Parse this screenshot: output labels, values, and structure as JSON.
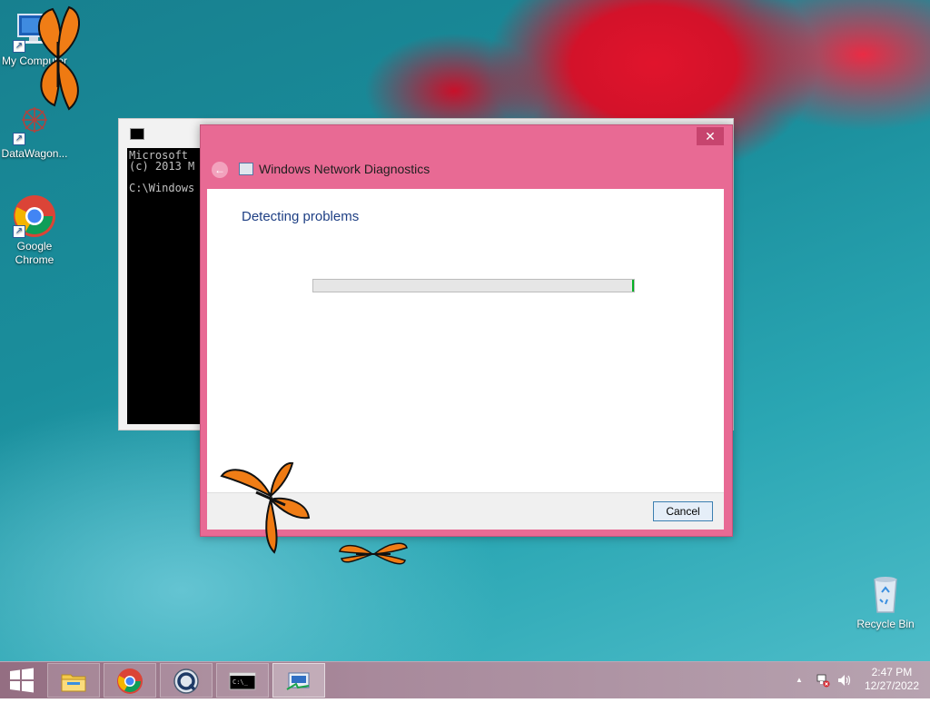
{
  "desktop": {
    "icons": [
      {
        "label": "My Computer"
      },
      {
        "label": "DataWagon..."
      },
      {
        "label": "Google Chrome"
      },
      {
        "label": "Recycle Bin"
      }
    ]
  },
  "cmd": {
    "line1": "Microsoft",
    "line2": "(c) 2013 M",
    "line3": "C:\\Windows"
  },
  "diagnostics": {
    "title": "Windows Network Diagnostics",
    "heading": "Detecting problems",
    "progress": 1.0,
    "cancel_label": "Cancel",
    "close_glyph": "✕",
    "back_glyph": "←"
  },
  "taskbar": {
    "items": [
      "start-button",
      "file-explorer",
      "google-chrome",
      "quicktime",
      "command-prompt",
      "network-diagnostics"
    ],
    "tray": {
      "show_hidden_glyph": "▲",
      "time": "2:47 PM",
      "date": "12/27/2022"
    }
  },
  "colors": {
    "window_accent": "#e86a94",
    "heading_blue": "#1e3f84",
    "progress_green": "#06b025"
  }
}
